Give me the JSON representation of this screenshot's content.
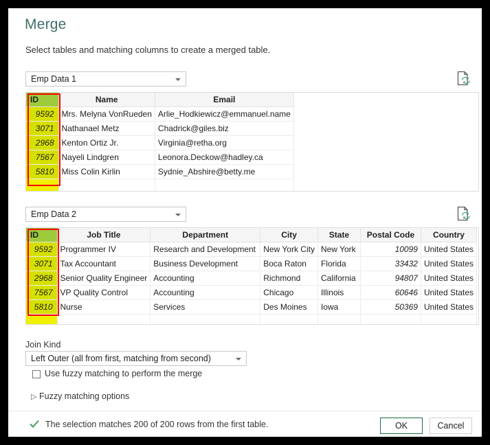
{
  "dialog": {
    "title": "Merge",
    "subtitle": "Select tables and matching columns to create a merged table."
  },
  "table1": {
    "selector_value": "Emp Data 1",
    "refresh_icon": "refresh-preview-icon",
    "columns": [
      "ID",
      "Name",
      "Email"
    ],
    "rows": [
      [
        "9592",
        "Mrs. Melyna VonRueden",
        "Arlie_Hodkiewicz@emmanuel.name"
      ],
      [
        "3071",
        "Nathanael Metz",
        "Chadrick@giles.biz"
      ],
      [
        "2968",
        "Kenton Ortiz Jr.",
        "Virginia@retha.org"
      ],
      [
        "7567",
        "Nayeli Lindgren",
        "Leonora.Deckow@hadley.ca"
      ],
      [
        "5810",
        "Miss Colin Kirlin",
        "Sydnie_Abshire@betty.me"
      ]
    ]
  },
  "table2": {
    "selector_value": "Emp Data 2",
    "refresh_icon": "refresh-preview-icon",
    "columns": [
      "ID",
      "Job Title",
      "Department",
      "City",
      "State",
      "Postal Code",
      "Country"
    ],
    "rows": [
      [
        "9592",
        "Programmer IV",
        "Research and Development",
        "New York City",
        "New York",
        "10099",
        "United States"
      ],
      [
        "3071",
        "Tax Accountant",
        "Business Development",
        "Boca Raton",
        "Florida",
        "33432",
        "United States"
      ],
      [
        "2968",
        "Senior Quality Engineer",
        "Accounting",
        "Richmond",
        "California",
        "94807",
        "United States"
      ],
      [
        "7567",
        "VP Quality Control",
        "Accounting",
        "Chicago",
        "Illinois",
        "60646",
        "United States"
      ],
      [
        "5810",
        "Nurse",
        "Services",
        "Des Moines",
        "Iowa",
        "50369",
        "United States"
      ]
    ]
  },
  "join": {
    "label": "Join Kind",
    "value": "Left Outer (all from first, matching from second)"
  },
  "fuzzy": {
    "checkbox_label": "Use fuzzy matching to perform the merge",
    "checked": false,
    "expander_label": "Fuzzy matching options",
    "expander_icon": "chevron-right-icon",
    "expanded": false
  },
  "footer": {
    "status_icon": "checkmark-icon",
    "status_text": "The selection matches 200 of 200 rows from the first table.",
    "ok_label": "OK",
    "cancel_label": "Cancel"
  },
  "colors": {
    "title": "#3e6d69",
    "key_header": "#9ecb3c",
    "key_cell": "#d6e000",
    "key_filler": "#f0f000",
    "annotation": "#ff0000",
    "primary_button_border": "#1f6c43",
    "status_check": "#4a9a5e"
  }
}
